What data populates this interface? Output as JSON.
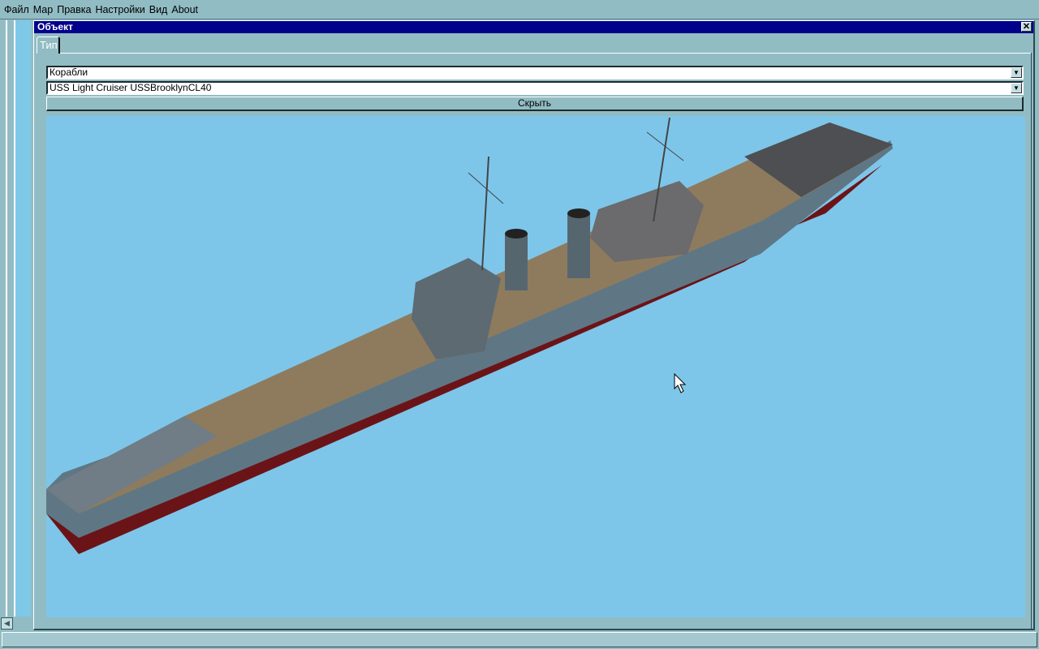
{
  "menu": [
    "Файл",
    "Мар",
    "Правка",
    "Настройки",
    "Вид",
    "About"
  ],
  "window": {
    "title": "Объект",
    "close": "✕"
  },
  "tabs": [
    {
      "label": "Тип"
    }
  ],
  "category_select": {
    "value": "Корабли"
  },
  "object_select": {
    "value": "USS  Light Cruiser USSBrooklynCL40"
  },
  "hide_button": "Скрыть",
  "dropdown_arrow": "▼",
  "scroll_left": "◀"
}
